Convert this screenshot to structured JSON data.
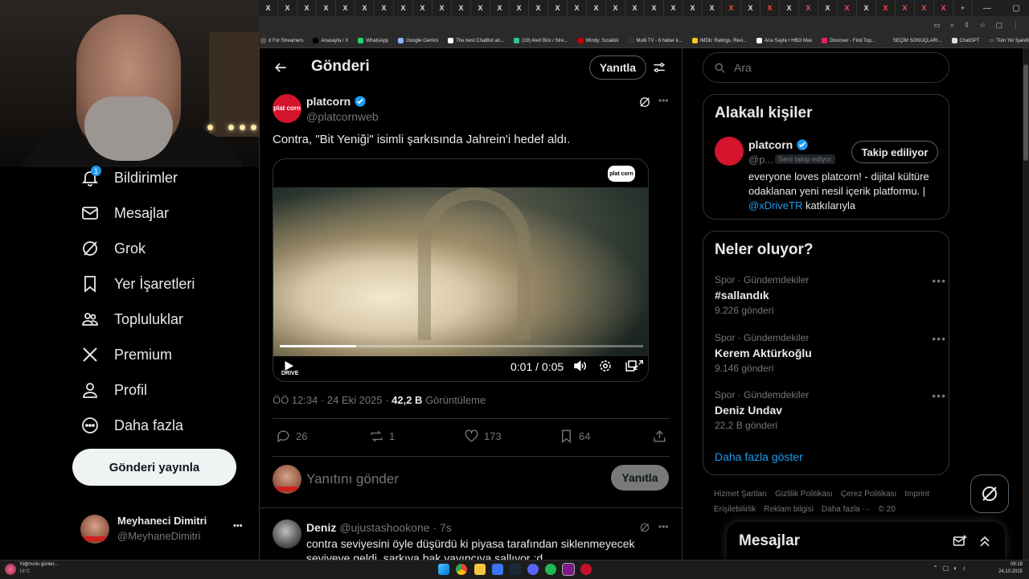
{
  "browser": {
    "tabs": [
      "X",
      "X",
      "X",
      "X",
      "X",
      "X",
      "X",
      "X",
      "X",
      "X",
      "X",
      "X",
      "X",
      "X",
      "X",
      "X",
      "X",
      "X",
      "X",
      "X",
      "X",
      "X",
      "X",
      "X",
      "X",
      "X",
      "X",
      "X",
      "X",
      "X",
      "X",
      "X",
      "X",
      "X",
      "X",
      "X"
    ],
    "new_tab": "+",
    "bookmarks": [
      {
        "label": "d For Streamers",
        "color": "#555"
      },
      {
        "label": "Anasayfa / X",
        "color": "#000"
      },
      {
        "label": "WhatsApp",
        "color": "#25d366"
      },
      {
        "label": "Google Gemini",
        "color": "#8ab4f8"
      },
      {
        "label": "The best ChatBot an...",
        "color": "#fff"
      },
      {
        "label": "(19) Alert Box / Stre...",
        "color": "#31c3a2"
      },
      {
        "label": "Windy: Sıcaklık",
        "color": "#c00"
      },
      {
        "label": "Multi TV - 6 haber k...",
        "color": "#333"
      },
      {
        "label": "IMDb: Ratings, Revi...",
        "color": "#f5c518"
      },
      {
        "label": "Ana Sayfa • HBO Max",
        "color": "#fff"
      },
      {
        "label": "Discover - Find Top...",
        "color": "#e91e63"
      },
      {
        "label": "SEÇİM SONUÇLARI...",
        "color": "#2a2a2a"
      },
      {
        "label": "ChatGPT",
        "color": "#ddd"
      }
    ],
    "bookmarks_all": "Tüm Yer İşaretleri"
  },
  "nav": {
    "notification_count": "1",
    "items": [
      {
        "label": "Bildirimler"
      },
      {
        "label": "Mesajlar"
      },
      {
        "label": "Grok"
      },
      {
        "label": "Yer İşaretleri"
      },
      {
        "label": "Topluluklar"
      },
      {
        "label": "Premium"
      },
      {
        "label": "Profil"
      },
      {
        "label": "Daha fazla"
      }
    ],
    "post_button": "Gönderi yayınla",
    "user": {
      "name": "Meyhaneci Dimitri",
      "handle": "@MeyhaneDimitri",
      "more": "•••"
    }
  },
  "post_page": {
    "header_title": "Gönderi",
    "reply_button": "Yanıtla",
    "author": {
      "name": "platcorn",
      "handle": "@platcornweb",
      "logo_text": "plat corn"
    },
    "text": "Contra, \"Bit Yeniği\" isimli şarkısında Jahrein'i hedef aldı.",
    "video": {
      "time": "0:01 / 0:05",
      "progress": 0.21,
      "watermark": "plat corn",
      "corner_brand": "DRIVE"
    },
    "timestamp": "ÖÖ 12:34 · 24 Eki 2025 · ",
    "views_value": "42,2 B",
    "views_label": " Görüntüleme",
    "stats": {
      "replies": "26",
      "reposts": "1",
      "likes": "173",
      "bookmarks": "64"
    },
    "reply_placeholder": "Yanıtını gönder",
    "reply_submit": "Yanıtla",
    "reply": {
      "name": "Deniz",
      "handle": "@ujustashookone",
      "time": " · 7s",
      "text": "contra seviyesini öyle düşürdü ki piyasa tarafından siklenmeyecek seviyeye geldi. şarkıya bak yayıncıya sallıyor :d"
    }
  },
  "sidebar": {
    "search_placeholder": "Ara",
    "relevant_title": "Alakalı kişiler",
    "relevant": {
      "name": "platcorn",
      "handle": "@p...",
      "follows_you": "Seni takip ediyor",
      "follow_button": "Takip ediliyor",
      "bio_1": "everyone loves platcorn! - dijital kültüre odaklanan yeni nesil içerik platformu. | ",
      "bio_mention": "@xDriveTR",
      "bio_2": " katkılarıyla"
    },
    "trends_title": "Neler oluyor?",
    "trends": [
      {
        "category": "Spor · Gündemdekiler",
        "title": "#sallandık",
        "count": "9.226 gönderi"
      },
      {
        "category": "Spor · Gündemdekiler",
        "title": "Kerem Aktürkoğlu",
        "count": "9.146 gönderi"
      },
      {
        "category": "Spor · Gündemdekiler",
        "title": "Deniz Undav",
        "count": "22,2 B gönderi"
      }
    ],
    "show_more": "Daha fazla göster",
    "footer": [
      "Hizmet Şartları",
      "Gizlilik Politikası",
      "Çerez Politikası",
      "Imprint",
      "Erişilebilirlik",
      "Reklam bilgisi",
      "Daha fazla ···"
    ],
    "copyright": "© 20",
    "messages_title": "Mesajlar"
  },
  "taskbar": {
    "weather_title": "Yağmurlu günler...",
    "weather_temp": "16°C",
    "clock_time": "08:19",
    "clock_date": "24.10.2025"
  }
}
